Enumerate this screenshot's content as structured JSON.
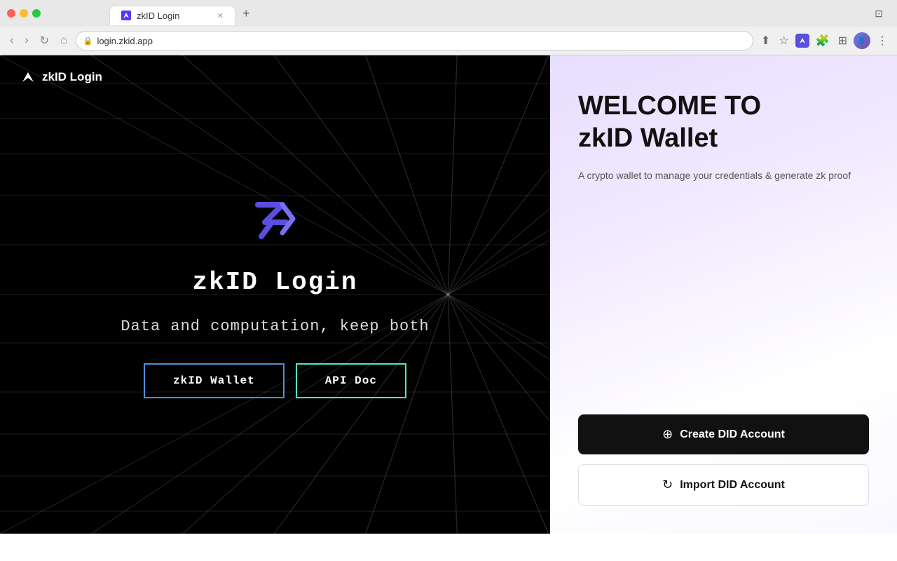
{
  "browser": {
    "tab_title": "zkID Login",
    "url": "login.zkid.app",
    "tab_new_label": "+",
    "nav_back": "‹",
    "nav_forward": "›",
    "nav_refresh": "↻",
    "nav_home": "⌂"
  },
  "header": {
    "logo_label": "zkID Login"
  },
  "main": {
    "site_title": "zkID Login",
    "tagline": "Data and computation, keep both",
    "nav_buttons": [
      {
        "label": "zkID Wallet",
        "style": "wallet"
      },
      {
        "label": "API Doc",
        "style": "api"
      }
    ]
  },
  "panel": {
    "welcome_line1": "WELCOME TO",
    "welcome_line2": "zkID Wallet",
    "subtitle": "A crypto wallet to manage your credentials & generate zk proof",
    "create_did_label": "Create DID Account",
    "import_did_label": "Import DID Account",
    "create_did_icon": "⊕",
    "import_did_icon": "↻"
  }
}
